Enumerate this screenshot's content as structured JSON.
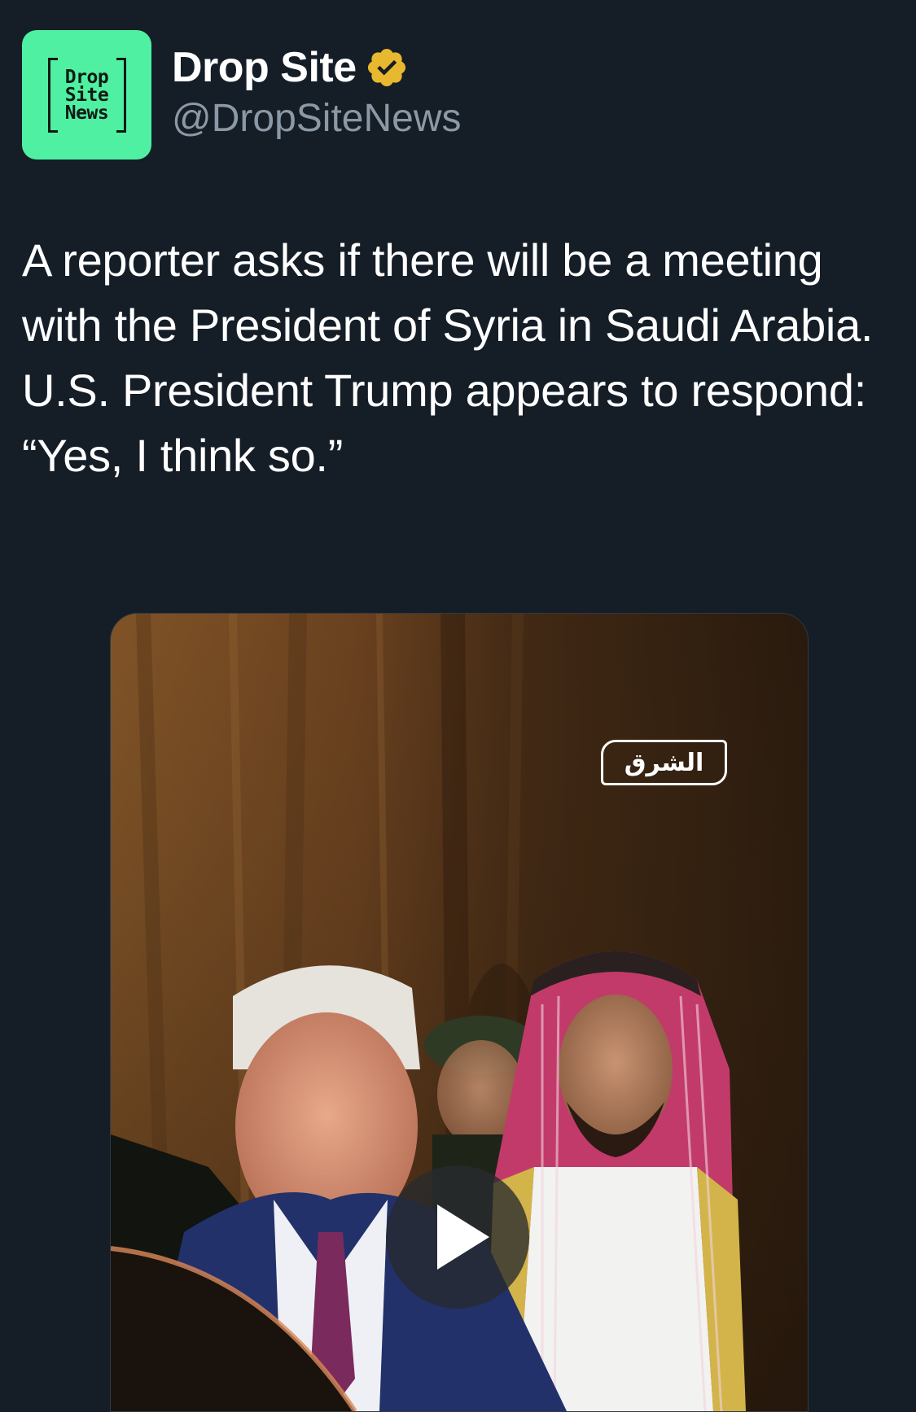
{
  "author": {
    "display_name": "Drop Site",
    "handle": "@DropSiteNews",
    "verified": true,
    "verified_color": "#e8b82e",
    "avatar": {
      "background": "#4ff0a2",
      "logo_lines": [
        "Drop",
        "Site",
        "News"
      ]
    }
  },
  "tweet": {
    "text": "A reporter asks if there will be a meeting with the President of Syria in Saudi Arabia.\nU.S. President Trump appears to respond: “Yes, I think so.”"
  },
  "media": {
    "type": "video",
    "channel_watermark": "الشرق",
    "play_icon": "play-icon"
  },
  "colors": {
    "background": "#151d27",
    "text_primary": "#ffffff",
    "text_secondary": "#8b98a5"
  }
}
